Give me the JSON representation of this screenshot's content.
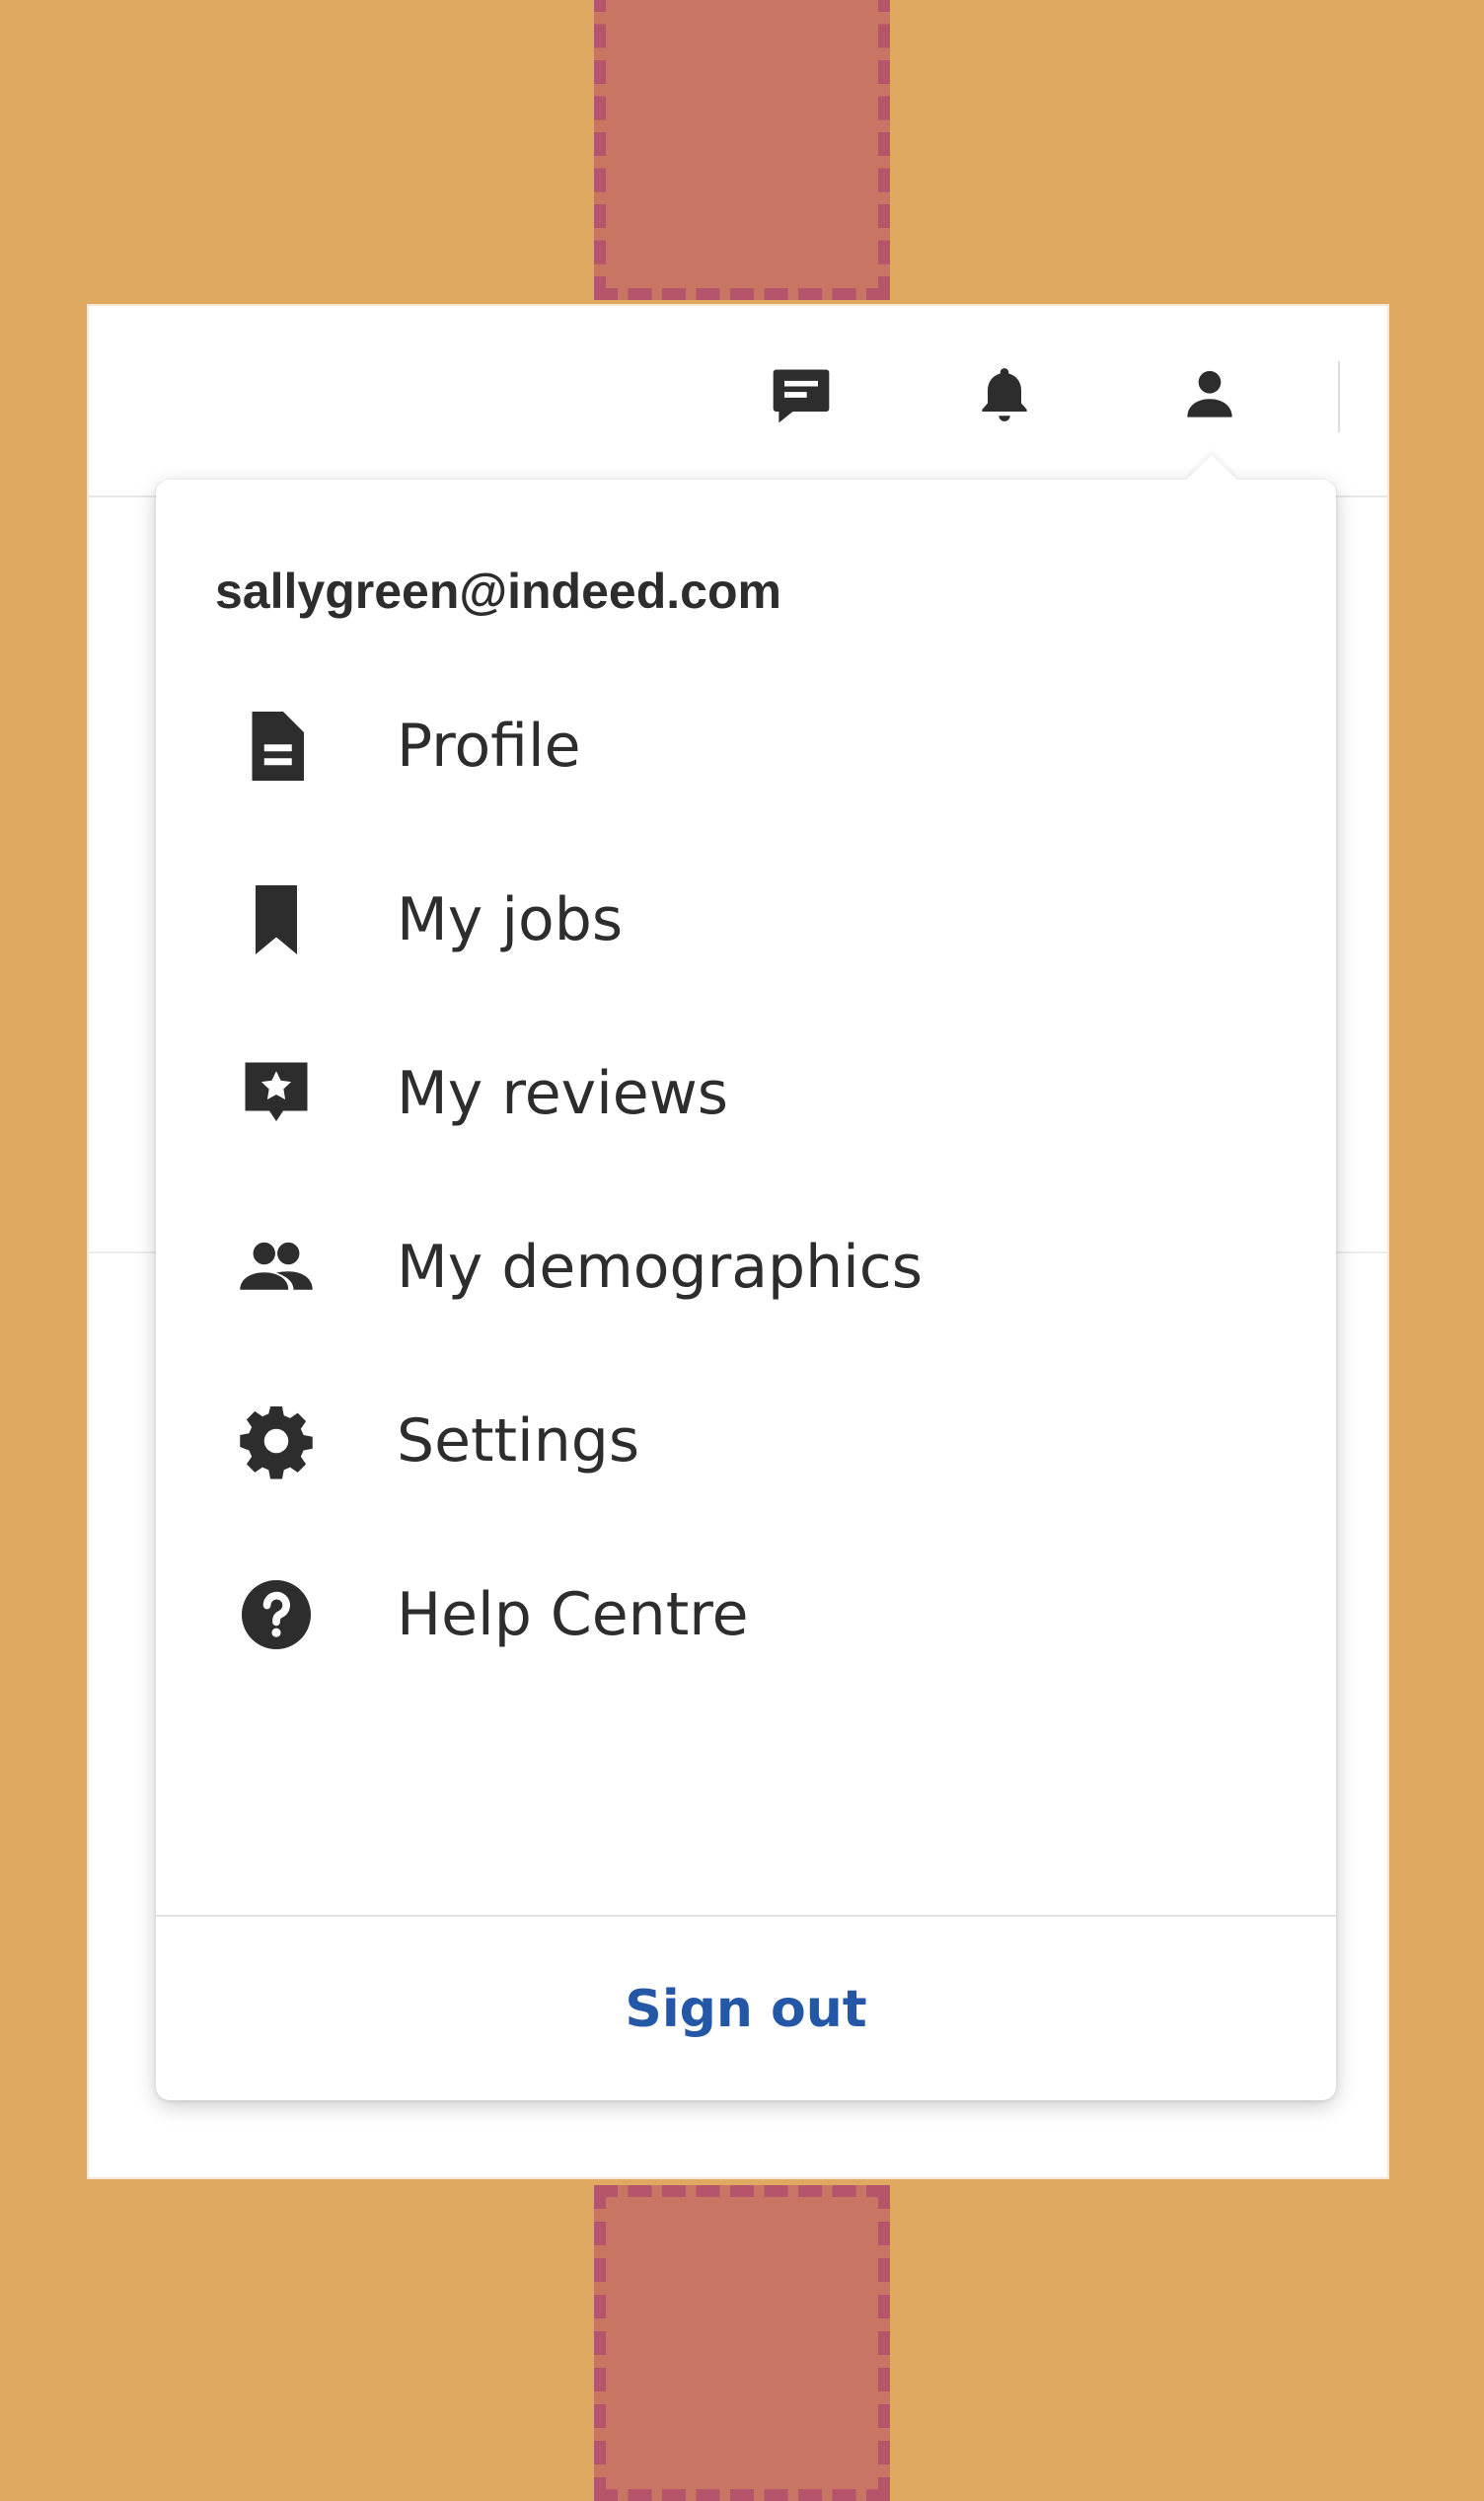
{
  "colors": {
    "background": "#E0A961",
    "spacer_fill": "#C87564",
    "spacer_border": "#B5546A",
    "text": "#2D2D2D",
    "link": "#2557A7"
  },
  "header": {
    "icons": [
      "messages-icon",
      "notifications-bell-icon",
      "account-person-icon"
    ]
  },
  "account_menu": {
    "email": "sallygreen@indeed.com",
    "items": [
      {
        "label": "Profile",
        "icon": "document-icon"
      },
      {
        "label": "My jobs",
        "icon": "bookmark-icon"
      },
      {
        "label": "My reviews",
        "icon": "review-star-icon"
      },
      {
        "label": "My demographics",
        "icon": "people-icon"
      },
      {
        "label": "Settings",
        "icon": "gear-icon"
      },
      {
        "label": "Help Centre",
        "icon": "help-circle-icon"
      }
    ],
    "sign_out_label": "Sign out"
  }
}
